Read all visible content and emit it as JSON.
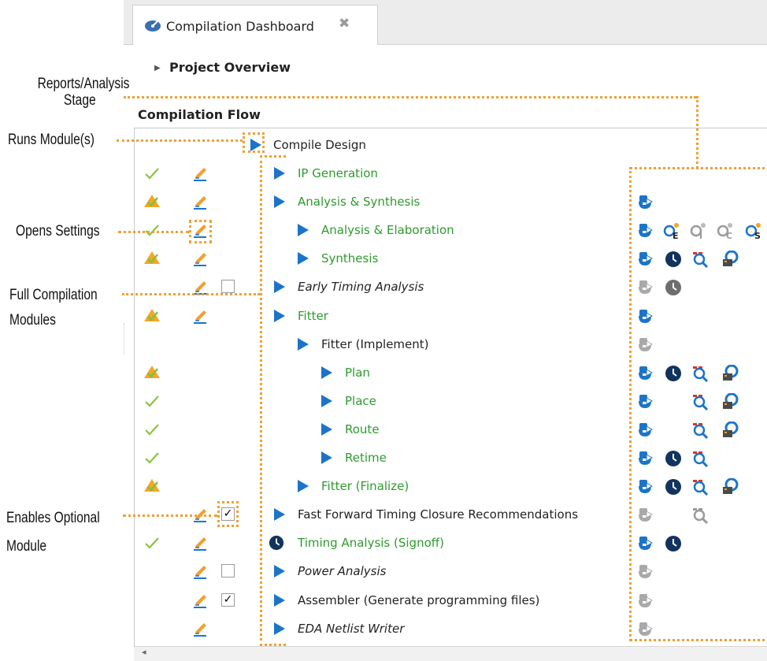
{
  "tab": {
    "title": "Compilation Dashboard",
    "icon": "dashboard-icon",
    "close": "✖"
  },
  "overview": {
    "label": "Project Overview"
  },
  "flow": {
    "title": "Compilation Flow",
    "compile_design": "Compile Design",
    "rows": [
      {
        "label": "IP Generation",
        "style": "green",
        "status": "check",
        "edit": true,
        "reports": []
      },
      {
        "label": "Analysis & Synthesis",
        "style": "green",
        "status": "warning",
        "edit": true,
        "reports": [
          "report"
        ]
      },
      {
        "label": "Analysis & Elaboration",
        "style": "green",
        "status": "check",
        "edit": true,
        "reports": [
          "report",
          "search-e",
          "search-i",
          "search-c",
          "search-s"
        ]
      },
      {
        "label": "Synthesis",
        "style": "green",
        "status": "warning",
        "edit": true,
        "reports": [
          "report",
          "clock",
          "search-red",
          "chip-view"
        ]
      },
      {
        "label": "Early Timing Analysis",
        "style": "italic",
        "status": "none",
        "edit": true,
        "checkbox": "unchecked",
        "reports": [
          "report-grey",
          "clock-grey"
        ]
      },
      {
        "label": "Fitter",
        "style": "green",
        "status": "warning",
        "edit": true,
        "reports": [
          "report"
        ]
      },
      {
        "label": "Fitter (Implement)",
        "style": "black",
        "status": "none",
        "edit": false,
        "reports": [
          "report-grey"
        ]
      },
      {
        "label": "Plan",
        "style": "green",
        "status": "warning",
        "edit": false,
        "reports": [
          "report",
          "clock",
          "search-red",
          "chip-view"
        ]
      },
      {
        "label": "Place",
        "style": "green",
        "status": "check",
        "edit": false,
        "reports": [
          "report",
          "search-red",
          "chip-view"
        ]
      },
      {
        "label": "Route",
        "style": "green",
        "status": "check",
        "edit": false,
        "reports": [
          "report",
          "search-red",
          "chip-view"
        ]
      },
      {
        "label": "Retime",
        "style": "green",
        "status": "check",
        "edit": false,
        "reports": [
          "report",
          "clock",
          "search-red"
        ]
      },
      {
        "label": "Fitter (Finalize)",
        "style": "green",
        "status": "warning",
        "edit": false,
        "reports": [
          "report",
          "clock",
          "search-red",
          "chip-view"
        ]
      },
      {
        "label": "Fast Forward Timing Closure Recommendations",
        "style": "black",
        "status": "none",
        "edit": true,
        "checkbox": "checked",
        "reports": [
          "report-grey",
          "search-grey"
        ]
      },
      {
        "label": "Timing Analysis (Signoff)",
        "style": "green",
        "status": "check",
        "edit": true,
        "reports": [
          "report",
          "clock"
        ]
      },
      {
        "label": "Power Analysis",
        "style": "italic",
        "status": "none",
        "edit": true,
        "checkbox": "unchecked",
        "reports": [
          "report-grey"
        ]
      },
      {
        "label": "Assembler (Generate programming files)",
        "style": "black",
        "status": "none",
        "edit": true,
        "checkbox": "checked",
        "reports": [
          "report-grey"
        ]
      },
      {
        "label": "EDA Netlist Writer",
        "style": "italic",
        "status": "none",
        "edit": true,
        "reports": [
          "report-grey"
        ]
      }
    ]
  },
  "callouts": {
    "reports_stage": "Reports/Analysis\nStage",
    "runs_module": "Runs Module(s)",
    "opens_settings": "Opens Settings",
    "full_compilation": "Full Compilation\nModules",
    "enables_optional": "Enables Optional\nModule"
  },
  "colors": {
    "accent": "#1c74c9",
    "completed": "#2e9a2e",
    "callout_line": "#f0a030",
    "warning": "#f0a030"
  }
}
